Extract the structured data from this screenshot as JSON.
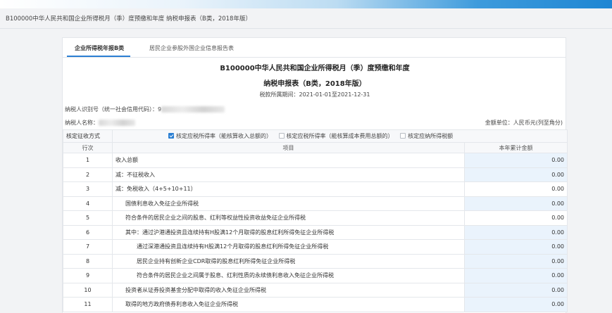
{
  "page": {
    "title": "B100000中华人民共和国企业所得税月（季）度预缴和年度 纳税申报表（B类，2018年版）"
  },
  "tabs": [
    {
      "label": "企业所得税年报B类",
      "active": true
    },
    {
      "label": "居民企业参股外国企业信息报告表",
      "active": false
    }
  ],
  "form": {
    "title_line1": "B100000中华人民共和国企业所得税月（季）度预缴和年度",
    "title_line2": "纳税申报表（B类，2018年版）",
    "period": "税款所属期间：2021-01-01至2021-12-31",
    "taxpayer_id_label": "纳税人识别号（统一社会信用代码）：9",
    "taxpayer_name_label": "纳税人名称：",
    "unit": "金额单位：人民币元(列至角分)",
    "levy_method": {
      "label": "核定征收方式",
      "options": [
        {
          "label": "核定应税所得率（能核算收入总额的）",
          "checked": true
        },
        {
          "label": "核定应税所得率（能核算成本费用总额的）",
          "checked": false
        },
        {
          "label": "核定应纳所得税额",
          "checked": false
        }
      ]
    },
    "headers": {
      "row_no": "行次",
      "item": "项目",
      "amount": "本年累计金额"
    },
    "rows": [
      {
        "no": "1",
        "item": "收入总额",
        "amount": "0.00",
        "indent": 0,
        "editable": true
      },
      {
        "no": "2",
        "item": "减：不征税收入",
        "amount": "0.00",
        "indent": 0,
        "editable": true
      },
      {
        "no": "3",
        "item": "减：免税收入（4+5+10+11）",
        "amount": "0.00",
        "indent": 0,
        "editable": false
      },
      {
        "no": "4",
        "item": "国债利息收入免征企业所得税",
        "amount": "0.00",
        "indent": 1,
        "editable": true
      },
      {
        "no": "5",
        "item": "符合条件的居民企业之间的股息、红利等权益性投资收益免征企业所得税",
        "amount": "0.00",
        "indent": 1,
        "editable": false
      },
      {
        "no": "6",
        "item": "其中：通过沪港通投资且连续持有H股满12个月取得的股息红利所得免征企业所得税",
        "amount": "0.00",
        "indent": 1,
        "editable": true
      },
      {
        "no": "7",
        "item": "通过深港通投资且连续持有H股满12个月取得的股息红利所得免征企业所得税",
        "amount": "0.00",
        "indent": 2,
        "editable": true
      },
      {
        "no": "8",
        "item": "居民企业持有创新企业CDR取得的股息红利所得免征企业所得税",
        "amount": "0.00",
        "indent": 2,
        "editable": true
      },
      {
        "no": "9",
        "item": "符合条件的居民企业之间属于股息、红利性质的永续债利息收入免征企业所得税",
        "amount": "0.00",
        "indent": 2,
        "editable": true
      },
      {
        "no": "10",
        "item": "投资者从证券投资基金分配中取得的收入免征企业所得税",
        "amount": "0.00",
        "indent": 1,
        "editable": true
      },
      {
        "no": "11",
        "item": "取得的地方政府债券利息收入免征企业所得税",
        "amount": "0.00",
        "indent": 1,
        "editable": true
      }
    ]
  },
  "colors": {
    "accent": "#2b7fd3",
    "editable_cell": "#eaf3fc",
    "editable_text": "#2f7fcf"
  }
}
